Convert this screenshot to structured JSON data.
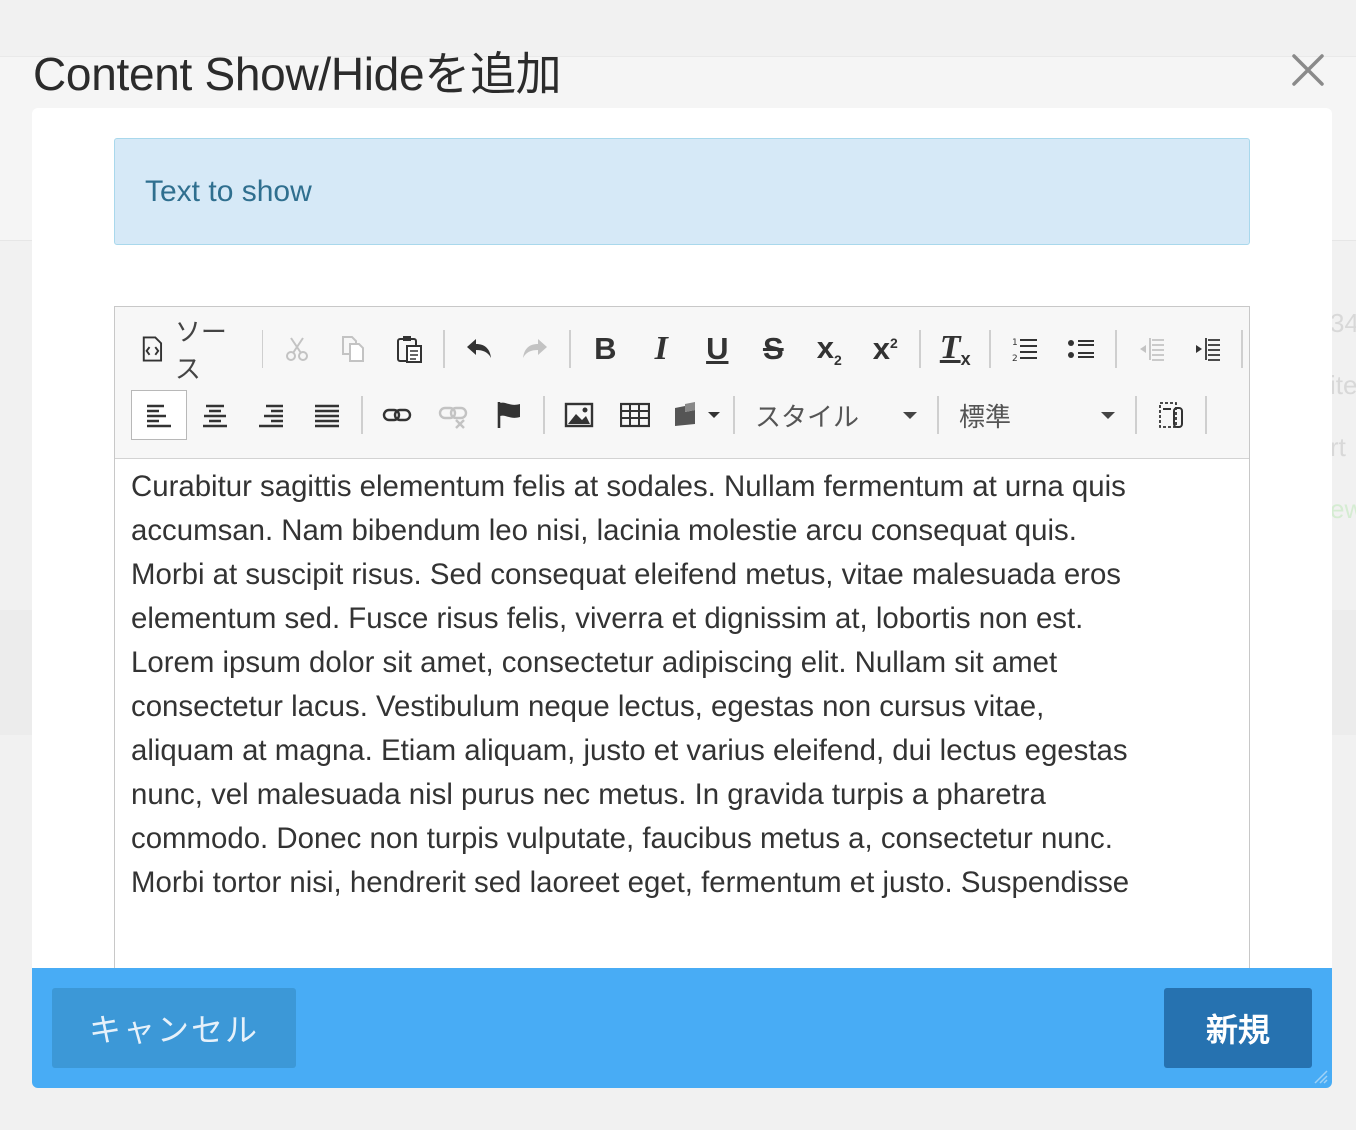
{
  "modal": {
    "title": "Content Show/Hideを追加"
  },
  "alert": {
    "text": "Text to show"
  },
  "toolbar": {
    "source_label": "ソース",
    "bold_label": "B",
    "italic_label": "I",
    "underline_label": "U",
    "strike_label": "S",
    "subscript_label": "x",
    "subscript_mark": "2",
    "superscript_label": "x",
    "superscript_mark": "2",
    "removeformat_label": "T",
    "removeformat_mark": "x",
    "style_combo": "スタイル",
    "format_combo": "標準"
  },
  "editor": {
    "lines": [
      "Curabitur sagittis elementum felis at sodales. Nullam fermentum at urna quis",
      "accumsan. Nam bibendum leo nisi, lacinia molestie arcu consequat quis.",
      "Morbi at suscipit risus. Sed consequat eleifend metus, vitae malesuada eros",
      "elementum sed. Fusce risus felis, viverra et dignissim at, lobortis non est.",
      "Lorem ipsum dolor sit amet, consectetur adipiscing elit. Nullam sit amet",
      "consectetur lacus. Vestibulum neque lectus, egestas non cursus vitae,",
      "aliquam at magna. Etiam aliquam, justo et varius eleifend, dui lectus egestas",
      "nunc, vel malesuada nisl purus nec metus. In gravida turpis a pharetra",
      "commodo. Donec non turpis vulputate, faucibus metus a, consectetur nunc.",
      "Morbi tortor nisi, hendrerit sed laoreet eget, fermentum et justo. Suspendisse"
    ]
  },
  "footer": {
    "cancel_label": "キャンセル",
    "submit_label": "新規"
  },
  "background": {
    "ghost_1": "34",
    "ghost_2": "ite",
    "ghost_3": "rt",
    "ghost_4": "ew"
  },
  "colors": {
    "footer": "#48acf5",
    "submit": "#2672b0",
    "cancel": "#3c98d7",
    "alert_bg": "#d6e9f7"
  }
}
